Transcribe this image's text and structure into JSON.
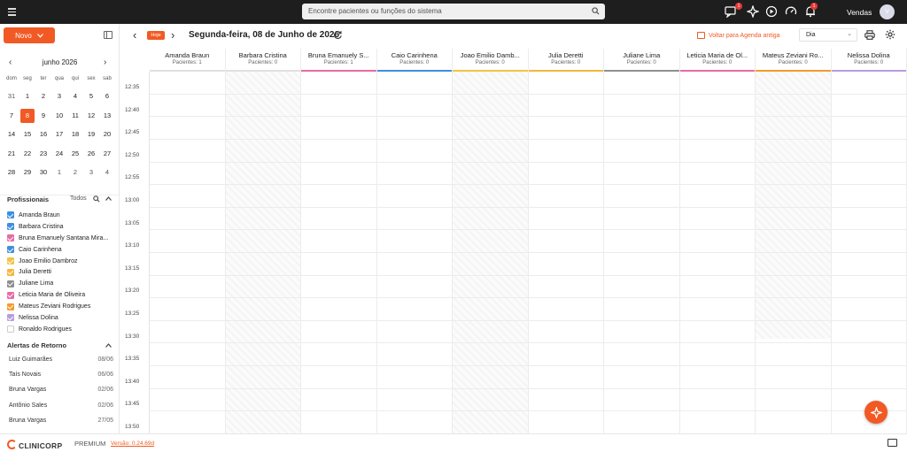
{
  "topbar": {
    "search_placeholder": "Encontre pacientes ou funções do sistema",
    "notification_badge_1": "1",
    "notification_badge_2": "1",
    "user_label": "Vendas",
    "avatar_initial": "V"
  },
  "sidebar": {
    "new_button": "Novo",
    "calendar": {
      "month_label": "junho 2026",
      "weekdays": [
        "dom",
        "seg",
        "ter",
        "qua",
        "qui",
        "sex",
        "sab"
      ],
      "days": [
        [
          "31",
          "1",
          "2",
          "3",
          "4",
          "5",
          "6"
        ],
        [
          "7",
          "8",
          "9",
          "10",
          "11",
          "12",
          "13"
        ],
        [
          "14",
          "15",
          "16",
          "17",
          "18",
          "19",
          "20"
        ],
        [
          "21",
          "22",
          "23",
          "24",
          "25",
          "26",
          "27"
        ],
        [
          "28",
          "29",
          "30",
          "1",
          "2",
          "3",
          "4"
        ]
      ],
      "selected_day": "8"
    },
    "professionals_title": "Profissionais",
    "professionals_all": "Todos",
    "professionals": [
      {
        "name": "Amanda Braun",
        "color": "#3d8fe0",
        "checked": true
      },
      {
        "name": "Barbara Cristina",
        "color": "#3d8fe0",
        "checked": true
      },
      {
        "name": "Bruna Emanuely Santana Mira...",
        "color": "#e86aa5",
        "checked": true
      },
      {
        "name": "Caio Carinhena",
        "color": "#3d8fe0",
        "checked": true
      },
      {
        "name": "Joao Emilio Dambroz",
        "color": "#f0c542",
        "checked": true
      },
      {
        "name": "Julia Deretti",
        "color": "#f5b63c",
        "checked": true
      },
      {
        "name": "Juliane Lima",
        "color": "#8f8f8f",
        "checked": true
      },
      {
        "name": "Leticia Maria de Oliveira",
        "color": "#e86aa5",
        "checked": true
      },
      {
        "name": "Mateus Zeviani Rodrigues",
        "color": "#f59b2b",
        "checked": true
      },
      {
        "name": "Nelissa Dolina",
        "color": "#b99be0",
        "checked": true
      },
      {
        "name": "Ronaldo Rodrigues",
        "color": "#ffffff",
        "checked": false
      }
    ],
    "alerts_title": "Alertas de Retorno",
    "alerts": [
      {
        "name": "Luiz Guimarães",
        "date": "08/06"
      },
      {
        "name": "Taís Novais",
        "date": "06/06"
      },
      {
        "name": "Bruna Vargas",
        "date": "02/06"
      },
      {
        "name": "Antônio Sales",
        "date": "02/06"
      },
      {
        "name": "Bruna Vargas",
        "date": "27/05"
      }
    ]
  },
  "header": {
    "today_button": "Hoje",
    "date_title": "Segunda-feira, 08 de Junho de 2026",
    "back_link": "Voltar para Agenda antiga",
    "view_select": "Dia"
  },
  "schedule": {
    "columns": [
      {
        "name": "Amanda Braun",
        "patients": "Pacientes: 1",
        "color": "#ffffff",
        "blocked": false
      },
      {
        "name": "Barbara Cristina",
        "patients": "Pacientes: 0",
        "color": "#ffffff",
        "blocked": true
      },
      {
        "name": "Bruna Emanuely S...",
        "patients": "Pacientes: 1",
        "color": "#e86aa5",
        "blocked": false
      },
      {
        "name": "Caio Carinhena",
        "patients": "Pacientes: 0",
        "color": "#3d8fe0",
        "blocked": false
      },
      {
        "name": "Joao Emilio Damb...",
        "patients": "Pacientes: 0",
        "color": "#f0c542",
        "blocked": true
      },
      {
        "name": "Julia Deretti",
        "patients": "Pacientes: 0",
        "color": "#f5b63c",
        "blocked": false
      },
      {
        "name": "Juliane Lima",
        "patients": "Pacientes: 0",
        "color": "#8f8f8f",
        "blocked": false
      },
      {
        "name": "Leticia Maria de Ol...",
        "patients": "Pacientes: 0",
        "color": "#e86aa5",
        "blocked": false
      },
      {
        "name": "Mateus Zeviani Ro...",
        "patients": "Pacientes: 0",
        "color": "#f59b2b",
        "blocked": "partial"
      },
      {
        "name": "Nelissa Dolina",
        "patients": "Pacientes: 0",
        "color": "#b99be0",
        "blocked": false
      }
    ],
    "times": [
      "12:35",
      "12:40",
      "12:45",
      "12:50",
      "12:55",
      "13:00",
      "13:05",
      "13:10",
      "13:15",
      "13:20",
      "13:25",
      "13:30",
      "13:35",
      "13:40",
      "13:45",
      "13:50"
    ]
  },
  "footer": {
    "brand": "CLINICORP",
    "plan": "PREMIUM",
    "version": "Versão: 0.24.69d"
  }
}
